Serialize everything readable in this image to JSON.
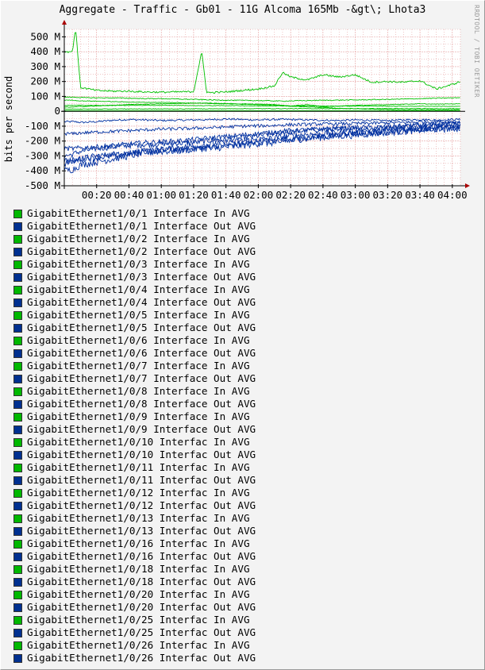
{
  "watermark": "RRDTOOL / TOBI OETIKER",
  "colors": {
    "background": "#f3f3f3",
    "canvas": "#ffffff",
    "grid": "#e6a0a0",
    "axis": "#000000",
    "in_series": "#00c000",
    "out_series": "#0030a0",
    "in_swatch": "#00b800",
    "out_swatch": "#003090",
    "arrow": "#aa0000"
  },
  "chart_data": {
    "type": "line",
    "title": "Aggregate - Traffic - Gb01 - 11G Alcoma 165Mb -&gt\\; Lhota3",
    "ylabel": "bits per second",
    "xlabel": "",
    "ylim": [
      -500,
      550
    ],
    "xlim": [
      "00:00",
      "04:05"
    ],
    "grid": true,
    "legend_placement": "bottom",
    "y_ticks": [
      {
        "value": 500,
        "label": "500 M"
      },
      {
        "value": 400,
        "label": "400 M"
      },
      {
        "value": 300,
        "label": "300 M"
      },
      {
        "value": 200,
        "label": "200 M"
      },
      {
        "value": 100,
        "label": "100 M"
      },
      {
        "value": 0,
        "label": "0"
      },
      {
        "value": -100,
        "label": "-100 M"
      },
      {
        "value": -200,
        "label": "-200 M"
      },
      {
        "value": -300,
        "label": "-300 M"
      },
      {
        "value": -400,
        "label": "-400 M"
      },
      {
        "value": -500,
        "label": "-500 M"
      }
    ],
    "x_ticks": [
      {
        "value": 20,
        "label": "00:20"
      },
      {
        "value": 40,
        "label": "00:40"
      },
      {
        "value": 60,
        "label": "01:00"
      },
      {
        "value": 80,
        "label": "01:20"
      },
      {
        "value": 100,
        "label": "01:40"
      },
      {
        "value": 120,
        "label": "02:00"
      },
      {
        "value": 140,
        "label": "02:20"
      },
      {
        "value": 160,
        "label": "02:40"
      },
      {
        "value": 180,
        "label": "03:00"
      },
      {
        "value": 200,
        "label": "03:20"
      },
      {
        "value": 220,
        "label": "03:40"
      },
      {
        "value": 240,
        "label": "04:00"
      }
    ],
    "series_profiles": {
      "x_minutes": [
        0,
        5,
        7,
        10,
        20,
        30,
        40,
        50,
        60,
        70,
        80,
        85,
        88,
        90,
        100,
        110,
        120,
        130,
        135,
        140,
        150,
        160,
        170,
        180,
        190,
        200,
        210,
        220,
        230,
        240,
        245
      ],
      "in": [
        [
          400,
          400,
          560,
          160,
          140,
          135,
          135,
          130,
          128,
          130,
          132,
          400,
          130,
          125,
          130,
          140,
          150,
          170,
          260,
          230,
          210,
          245,
          230,
          245,
          195,
          200,
          195,
          205,
          150,
          180,
          200
        ],
        [
          95,
          95,
          95,
          92,
          90,
          90,
          88,
          85,
          85,
          82,
          80,
          78,
          78,
          76,
          75,
          73,
          72,
          70,
          68,
          70,
          72,
          74,
          75,
          76,
          78,
          80,
          82,
          85,
          88,
          90,
          92
        ],
        [
          75,
          75,
          72,
          70,
          68,
          65,
          62,
          60,
          60,
          58,
          55,
          55,
          55,
          52,
          50,
          48,
          45,
          40,
          38,
          35,
          45,
          30,
          35,
          40,
          42,
          45,
          48,
          50,
          48,
          50,
          50
        ],
        [
          40,
          40,
          40,
          40,
          40,
          40,
          40,
          40,
          40,
          40,
          38,
          38,
          38,
          38,
          38,
          38,
          36,
          36,
          36,
          36,
          36,
          35,
          35,
          35,
          35,
          34,
          34,
          34,
          34,
          33,
          33
        ],
        [
          28,
          28,
          30,
          32,
          35,
          40,
          45,
          48,
          50,
          52,
          55,
          55,
          55,
          55,
          52,
          50,
          48,
          45,
          40,
          35,
          30,
          25,
          20,
          18,
          15,
          12,
          10,
          10,
          10,
          10,
          10
        ],
        [
          15,
          15,
          15,
          15,
          15,
          16,
          16,
          16,
          16,
          16,
          17,
          17,
          17,
          17,
          17,
          18,
          18,
          18,
          18,
          18,
          18,
          18,
          18,
          18,
          18,
          18,
          18,
          18,
          18,
          18,
          18
        ],
        [
          5,
          5,
          5,
          5,
          5,
          5,
          5,
          5,
          5,
          5,
          5,
          5,
          5,
          5,
          5,
          5,
          5,
          5,
          5,
          5,
          5,
          5,
          5,
          5,
          5,
          5,
          5,
          5,
          5,
          5,
          5
        ]
      ],
      "out": [
        [
          -70,
          -70,
          -70,
          -75,
          -70,
          -60,
          -55,
          -58,
          -62,
          -60,
          -58,
          -55,
          -60,
          -55,
          -52,
          -55,
          -58,
          -55,
          -55,
          -55,
          -58,
          -60,
          -62,
          -58,
          -60,
          -62,
          -58,
          -55,
          -60,
          -55,
          -55
        ],
        [
          -300,
          -290,
          -280,
          -270,
          -250,
          -240,
          -230,
          -225,
          -220,
          -215,
          -210,
          -205,
          -200,
          -195,
          -190,
          -180,
          -165,
          -150,
          -140,
          -140,
          -130,
          -120,
          -120,
          -110,
          -120,
          -110,
          -100,
          -90,
          -95,
          -85,
          -85
        ],
        [
          -350,
          -340,
          -330,
          -320,
          -300,
          -290,
          -280,
          -270,
          -260,
          -260,
          -250,
          -245,
          -240,
          -240,
          -230,
          -220,
          -200,
          -200,
          -190,
          -185,
          -180,
          -170,
          -160,
          -150,
          -145,
          -140,
          -125,
          -115,
          -110,
          -100,
          -100
        ],
        [
          -400,
          -390,
          -380,
          -360,
          -340,
          -320,
          -300,
          -280,
          -270,
          -265,
          -255,
          -250,
          -248,
          -245,
          -240,
          -230,
          -215,
          -210,
          -200,
          -195,
          -180,
          -175,
          -165,
          -160,
          -150,
          -140,
          -135,
          -125,
          -120,
          -115,
          -115
        ],
        [
          -330,
          -330,
          -330,
          -320,
          -310,
          -300,
          -285,
          -270,
          -255,
          -245,
          -235,
          -230,
          -225,
          -220,
          -210,
          -200,
          -190,
          -180,
          -170,
          -165,
          -155,
          -150,
          -145,
          -140,
          -135,
          -130,
          -125,
          -120,
          -115,
          -110,
          -110
        ],
        [
          -250,
          -250,
          -250,
          -245,
          -240,
          -230,
          -220,
          -210,
          -205,
          -200,
          -190,
          -185,
          -180,
          -180,
          -170,
          -160,
          -150,
          -140,
          -135,
          -130,
          -125,
          -120,
          -115,
          -110,
          -108,
          -105,
          -100,
          -95,
          -90,
          -85,
          -85
        ],
        [
          -150,
          -150,
          -150,
          -145,
          -140,
          -135,
          -130,
          -125,
          -120,
          -118,
          -115,
          -112,
          -110,
          -110,
          -105,
          -100,
          -98,
          -95,
          -92,
          -90,
          -88,
          -85,
          -85,
          -82,
          -80,
          -78,
          -75,
          -72,
          -70,
          -70,
          -70
        ]
      ]
    }
  },
  "legend": [
    {
      "label": "GigabitEthernet1/0/1 Interface In AVG",
      "kind": "in"
    },
    {
      "label": "GigabitEthernet1/0/1 Interface Out AVG",
      "kind": "out"
    },
    {
      "label": "GigabitEthernet1/0/2 Interface In AVG",
      "kind": "in"
    },
    {
      "label": "GigabitEthernet1/0/2 Interface Out AVG",
      "kind": "out"
    },
    {
      "label": "GigabitEthernet1/0/3 Interface In AVG",
      "kind": "in"
    },
    {
      "label": "GigabitEthernet1/0/3 Interface Out AVG",
      "kind": "out"
    },
    {
      "label": "GigabitEthernet1/0/4 Interface In AVG",
      "kind": "in"
    },
    {
      "label": "GigabitEthernet1/0/4 Interface Out AVG",
      "kind": "out"
    },
    {
      "label": "GigabitEthernet1/0/5 Interface In AVG",
      "kind": "in"
    },
    {
      "label": "GigabitEthernet1/0/5 Interface Out AVG",
      "kind": "out"
    },
    {
      "label": "GigabitEthernet1/0/6 Interface In AVG",
      "kind": "in"
    },
    {
      "label": "GigabitEthernet1/0/6 Interface Out AVG",
      "kind": "out"
    },
    {
      "label": "GigabitEthernet1/0/7 Interface In AVG",
      "kind": "in"
    },
    {
      "label": "GigabitEthernet1/0/7 Interface Out AVG",
      "kind": "out"
    },
    {
      "label": "GigabitEthernet1/0/8 Interface In AVG",
      "kind": "in"
    },
    {
      "label": "GigabitEthernet1/0/8 Interface Out AVG",
      "kind": "out"
    },
    {
      "label": "GigabitEthernet1/0/9 Interface In AVG",
      "kind": "in"
    },
    {
      "label": "GigabitEthernet1/0/9 Interface Out AVG",
      "kind": "out"
    },
    {
      "label": "GigabitEthernet1/0/10 Interfac In AVG",
      "kind": "in"
    },
    {
      "label": "GigabitEthernet1/0/10 Interfac Out AVG",
      "kind": "out"
    },
    {
      "label": "GigabitEthernet1/0/11 Interfac In AVG",
      "kind": "in"
    },
    {
      "label": "GigabitEthernet1/0/11 Interfac Out AVG",
      "kind": "out"
    },
    {
      "label": "GigabitEthernet1/0/12 Interfac In AVG",
      "kind": "in"
    },
    {
      "label": "GigabitEthernet1/0/12 Interfac Out AVG",
      "kind": "out"
    },
    {
      "label": "GigabitEthernet1/0/13 Interfac In AVG",
      "kind": "in"
    },
    {
      "label": "GigabitEthernet1/0/13 Interfac Out AVG",
      "kind": "out"
    },
    {
      "label": "GigabitEthernet1/0/16 Interfac In AVG",
      "kind": "in"
    },
    {
      "label": "GigabitEthernet1/0/16 Interfac Out AVG",
      "kind": "out"
    },
    {
      "label": "GigabitEthernet1/0/18 Interfac In AVG",
      "kind": "in"
    },
    {
      "label": "GigabitEthernet1/0/18 Interfac Out AVG",
      "kind": "out"
    },
    {
      "label": "GigabitEthernet1/0/20 Interfac In AVG",
      "kind": "in"
    },
    {
      "label": "GigabitEthernet1/0/20 Interfac Out AVG",
      "kind": "out"
    },
    {
      "label": "GigabitEthernet1/0/25 Interfac In AVG",
      "kind": "in"
    },
    {
      "label": "GigabitEthernet1/0/25 Interfac Out AVG",
      "kind": "out"
    },
    {
      "label": "GigabitEthernet1/0/26 Interfac In AVG",
      "kind": "in"
    },
    {
      "label": "GigabitEthernet1/0/26 Interfac Out AVG",
      "kind": "out"
    }
  ]
}
